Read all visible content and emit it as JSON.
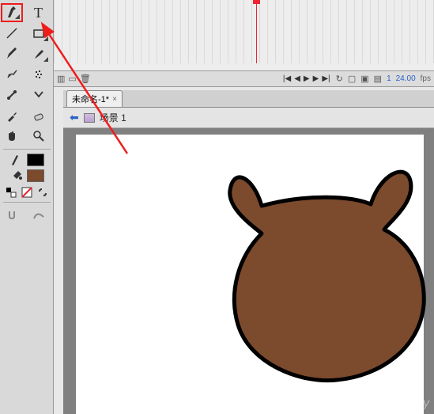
{
  "tools": {
    "pen": "pen-tool",
    "text": "T",
    "line": "line-tool",
    "rect": "rect-tool",
    "pencil": "pencil-tool",
    "brush": "brush-tool",
    "lasso": "lasso-tool",
    "deco": "deco-tool",
    "bone": "bone-tool",
    "bind": "bind-tool",
    "eyedrop": "eyedropper",
    "eraser": "eraser",
    "hand": "hand-tool",
    "zoom": "zoom-tool"
  },
  "colors": {
    "stroke": "#000000",
    "fill": "#7c4a2d"
  },
  "status": {
    "frame": "1",
    "fps_value": "24.00",
    "fps_label": "fps"
  },
  "document": {
    "tab_label": "未命名-1*",
    "scene_label": "场景 1"
  },
  "watermark": "jingy",
  "chart_data": null
}
